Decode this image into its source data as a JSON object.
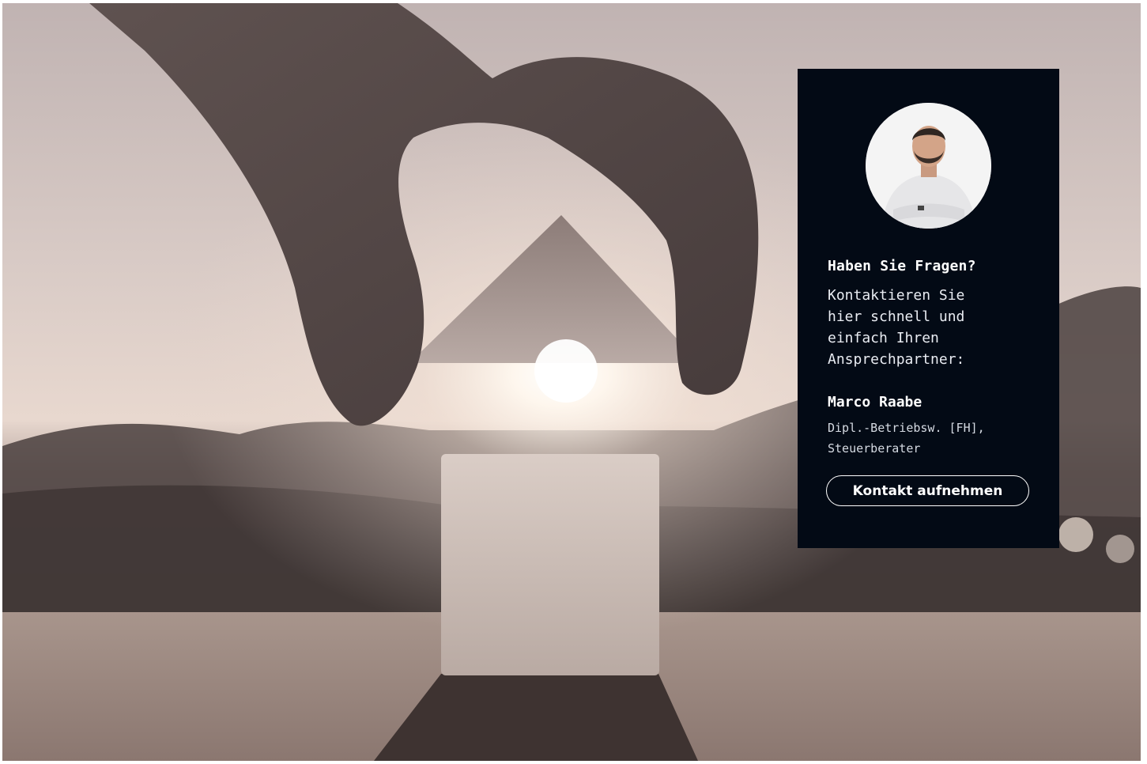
{
  "hero": {
    "image_description_icon": "hand-placing-house-roof-photo"
  },
  "contact_card": {
    "background_color": "#030a15",
    "heading": "Haben Sie Fragen?",
    "text": "Kontaktieren Sie\nhier schnell und\neinfach Ihren\nAnsprechpartner:",
    "person": {
      "name": "Marco Raabe",
      "role": "Dipl.-Betriebsw. [FH],\nSteuerberater"
    },
    "button_label": "Kontakt aufnehmen"
  }
}
